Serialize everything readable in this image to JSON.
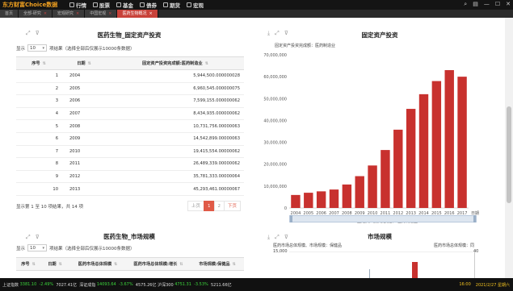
{
  "app": {
    "logo": "东方财富Choice数据",
    "menu": [
      {
        "label": "行情",
        "icon": "quote-icon"
      },
      {
        "label": "股票",
        "icon": "stock-icon"
      },
      {
        "label": "基金",
        "icon": "fund-icon"
      },
      {
        "label": "债券",
        "icon": "bond-icon"
      },
      {
        "label": "期货",
        "icon": "futures-icon"
      },
      {
        "label": "宏观",
        "icon": "macro-icon"
      }
    ],
    "window_controls": [
      "⌕",
      "▤",
      "—",
      "☐",
      "✕"
    ]
  },
  "tabs": [
    {
      "label": "首页",
      "active": false
    },
    {
      "label": "全部-研究",
      "active": false
    },
    {
      "label": "宏观研究",
      "active": false
    },
    {
      "label": "中国宏观",
      "active": false
    },
    {
      "label": "医药生物概况",
      "active": true
    }
  ],
  "left_panel": {
    "title": "医药生物_固定资产投资",
    "show_label": "显示",
    "page_size": "10",
    "page_size_suffix": "项结果（选择全部后仅展示10000条数据）",
    "columns": [
      "序号",
      "日期",
      "固定资产投资完成额:医药制造业"
    ],
    "rows": [
      {
        "n": "1",
        "date": "2004",
        "value": "5,944,500.000000028"
      },
      {
        "n": "2",
        "date": "2005",
        "value": "6,960,545.000000075"
      },
      {
        "n": "3",
        "date": "2006",
        "value": "7,599,155.000000062"
      },
      {
        "n": "4",
        "date": "2007",
        "value": "8,434,935.000000062"
      },
      {
        "n": "5",
        "date": "2008",
        "value": "10,731,756.00000063"
      },
      {
        "n": "6",
        "date": "2009",
        "value": "14,542,899.00000063"
      },
      {
        "n": "7",
        "date": "2010",
        "value": "19,415,554.00000062"
      },
      {
        "n": "8",
        "date": "2011",
        "value": "26,489,339.00000062"
      },
      {
        "n": "9",
        "date": "2012",
        "value": "35,781,333.00000064"
      },
      {
        "n": "10",
        "date": "2013",
        "value": "45,293,461.00000067"
      }
    ],
    "info": "显示第 1 至 10 项结果，共 14 项",
    "pager": {
      "prev": "上页",
      "p1": "1",
      "p2": "2",
      "next": "下页"
    }
  },
  "right_panel": {
    "title": "固定资产投资",
    "subtitle": "固定资产投资完成额：医药制造业"
  },
  "left_panel2": {
    "title": "医药生物_市场规模",
    "show_label": "显示",
    "page_size": "10",
    "page_size_suffix": "项结果（选择全部后仅展示10000条数据）",
    "columns": [
      "序号",
      "日期",
      "医药市场总体规模",
      "医药市场总体规模:增长",
      "市场规模:保健品"
    ]
  },
  "right_panel2": {
    "title": "市场规模",
    "left_label": "医药市场总体规模、市场规模：保健品",
    "right_label": "医药市场总体规模：同",
    "y_top_left": "15,000",
    "y_top_right": "40"
  },
  "status": {
    "items": [
      {
        "label": "上证指数",
        "cls": "w"
      },
      {
        "label": "3381.10",
        "cls": "g"
      },
      {
        "label": "-2.49%",
        "cls": "g"
      },
      {
        "label": "7027.41亿",
        "cls": "w"
      },
      {
        "label": "深证成指",
        "cls": "w"
      },
      {
        "label": "14093.64",
        "cls": "g"
      },
      {
        "label": "-3.67%",
        "cls": "g"
      },
      {
        "label": "4575.26亿",
        "cls": "w"
      },
      {
        "label": "沪深300",
        "cls": "w"
      },
      {
        "label": "4751.31",
        "cls": "g"
      },
      {
        "label": "-3.53%",
        "cls": "g"
      },
      {
        "label": "5211.66亿",
        "cls": "w"
      }
    ],
    "time": "16:00",
    "date": "2021/2/27 星期六"
  },
  "chart_data": [
    {
      "type": "bar",
      "title": "固定资产投资",
      "ylabel": "固定资产投资完成额：医药制造业",
      "xlabel": "日期",
      "categories": [
        "2004",
        "2005",
        "2006",
        "2007",
        "2008",
        "2009",
        "2010",
        "2011",
        "2012",
        "2013",
        "2014",
        "2015",
        "2016",
        "2017"
      ],
      "series": [
        {
          "name": "固定资产投资完成额：医药制造业",
          "color": "#c8312e",
          "values": [
            5944500,
            6960545,
            7599155,
            8434935,
            10731756,
            14542899,
            19415554,
            26489339,
            35781333,
            45293461,
            52000000,
            58000000,
            63000000,
            60000000
          ]
        }
      ],
      "yticks": [
        "0",
        "10,000,000",
        "20,000,000",
        "30,000,000",
        "40,000,000",
        "50,000,000",
        "60,000,000",
        "70,000,000"
      ],
      "ylim": [
        0,
        70000000
      ],
      "grid": false,
      "legend": "bottom"
    }
  ]
}
